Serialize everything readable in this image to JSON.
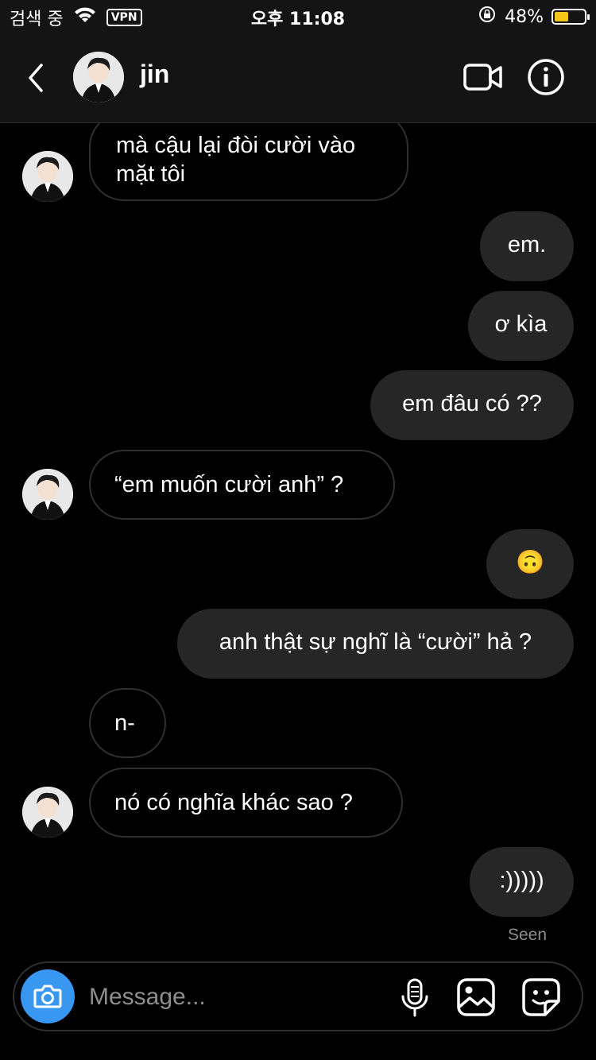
{
  "status_bar": {
    "carrier": "검색 중",
    "vpn": "VPN",
    "time": "오후 11:08",
    "battery_percent": "48%",
    "battery_level": 0.48,
    "battery_color": "#f5c518"
  },
  "header": {
    "contact_name": "jin",
    "back_icon": "chevron-left-icon",
    "video_icon": "video-camera-icon",
    "info_icon": "info-icon"
  },
  "messages": [
    {
      "direction": "in",
      "text": "mà cậu lại đòi cười vào mặt tôi"
    },
    {
      "direction": "out",
      "text": "em."
    },
    {
      "direction": "out",
      "text": "ơ kìa"
    },
    {
      "direction": "out",
      "text": "em đâu có ??"
    },
    {
      "direction": "in",
      "text": "“em muốn cười anh” ?"
    },
    {
      "direction": "out",
      "text": "🙃"
    },
    {
      "direction": "out",
      "text": "anh thật sự nghĩ là “cười” hả ?"
    },
    {
      "direction": "in",
      "text": "n-"
    },
    {
      "direction": "in",
      "text": "nó có nghĩa khác sao ?"
    },
    {
      "direction": "out",
      "text": ":)))))"
    }
  ],
  "seen_label": "Seen",
  "composer": {
    "placeholder": "Message...",
    "camera_icon": "camera-icon",
    "mic_icon": "microphone-icon",
    "gallery_icon": "image-icon",
    "sticker_icon": "sticker-icon",
    "camera_color": "#3897f0"
  }
}
